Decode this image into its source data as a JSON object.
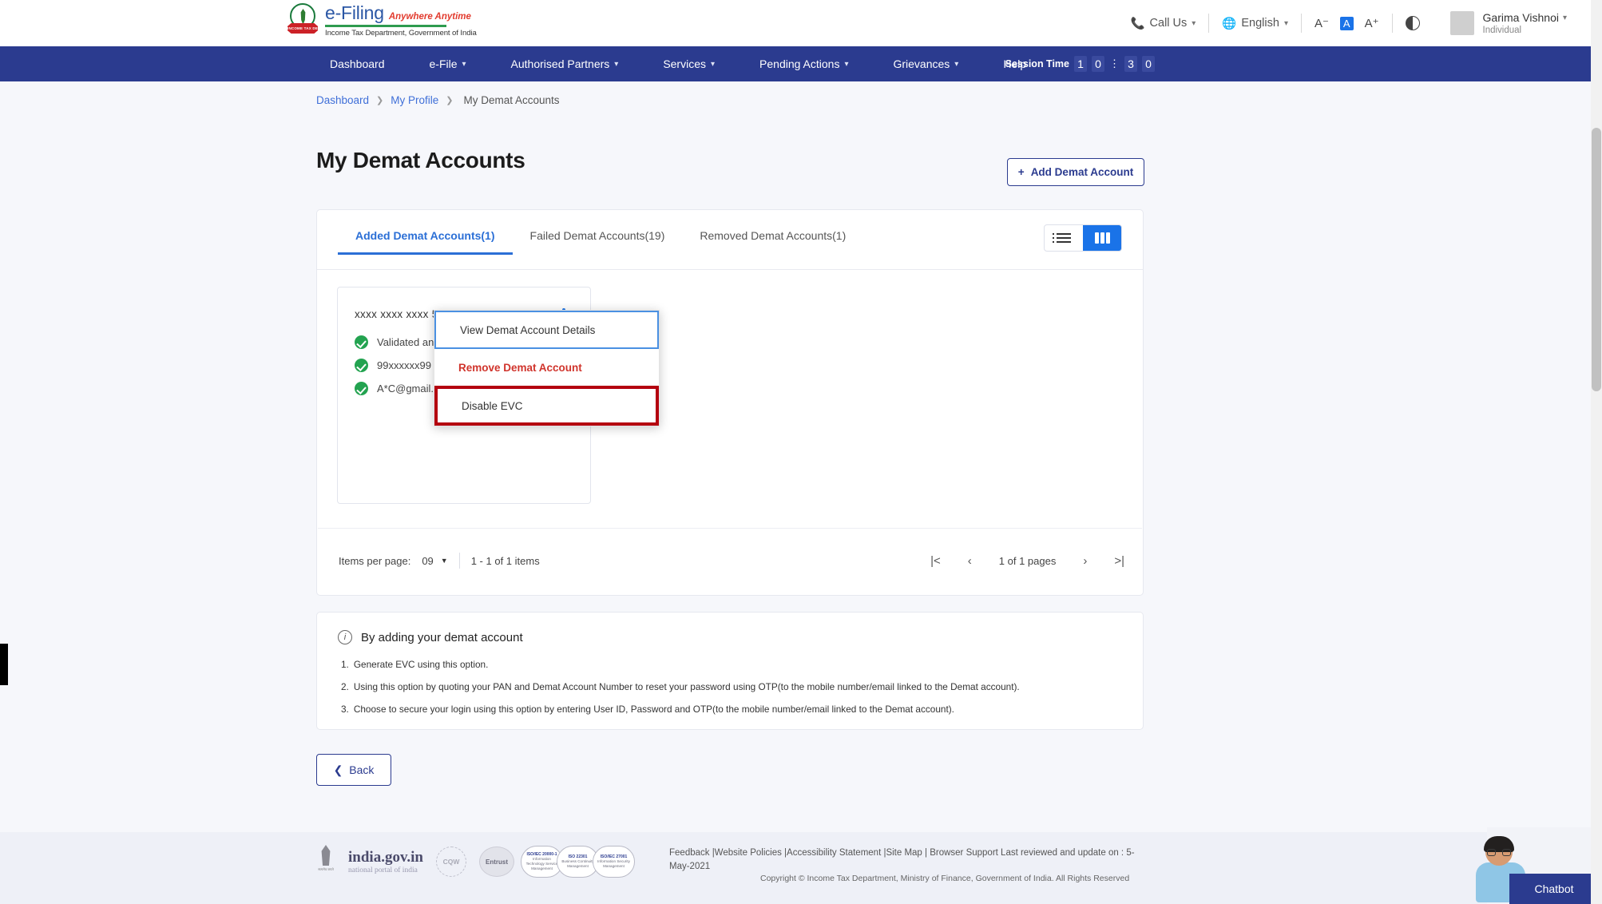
{
  "header": {
    "logo": {
      "brand": "e-Filing",
      "tagline": "Anywhere Anytime",
      "department": "Income Tax Department, Government of India",
      "emblem_text": "INCOME TAX DEPARTMENT"
    },
    "call_us": "Call Us",
    "language": "English",
    "font_decrease": "A⁻",
    "font_normal": "A",
    "font_increase": "A⁺",
    "user": {
      "name": "Garima Vishnoi",
      "role": "Individual"
    }
  },
  "nav": {
    "items": [
      {
        "label": "Dashboard",
        "has_caret": false
      },
      {
        "label": "e-File",
        "has_caret": true
      },
      {
        "label": "Authorised Partners",
        "has_caret": true
      },
      {
        "label": "Services",
        "has_caret": true
      },
      {
        "label": "Pending Actions",
        "has_caret": true
      },
      {
        "label": "Grievances",
        "has_caret": true
      },
      {
        "label": "Help",
        "has_caret": false
      }
    ],
    "session_label": "Session Time",
    "session_digits": [
      "1",
      "0",
      "3",
      "0"
    ],
    "session_time": "10:30"
  },
  "breadcrumb": {
    "items": [
      "Dashboard",
      "My Profile"
    ],
    "current": "My Demat Accounts"
  },
  "page_title": "My Demat Accounts",
  "add_button": "Add Demat Account",
  "tabs": [
    {
      "label": "Added Demat Accounts(1)",
      "active": true
    },
    {
      "label": "Failed Demat Accounts(19)",
      "active": false
    },
    {
      "label": "Removed Demat Accounts(1)",
      "active": false
    }
  ],
  "view_toggle": {
    "list": "list-view",
    "grid": "grid-view",
    "active": "grid"
  },
  "demat_card": {
    "account_number": "xxxx xxxx xxxx 5678",
    "rows": [
      "Validated and EVC Enabled",
      "99xxxxxx99",
      "A*C@gmail.com"
    ]
  },
  "menu": {
    "items": [
      {
        "label": "View Demat Account Details",
        "style": "focused"
      },
      {
        "label": "Remove Demat Account",
        "style": "danger"
      },
      {
        "label": "Disable EVC",
        "style": "highlight"
      }
    ]
  },
  "pagination": {
    "items_per_page_label": "Items per page:",
    "items_per_page_value": "09",
    "range_text": "1 - 1 of 1 items",
    "page_text": "1 of 1 pages",
    "first": "|<",
    "prev": "‹",
    "next": "›",
    "last": ">|"
  },
  "info": {
    "heading": "By adding your demat account",
    "items": [
      {
        "n": "1.",
        "text": "Generate EVC using this option."
      },
      {
        "n": "2.",
        "text": "Using this option by quoting your PAN and Demat Account Number to reset your password using OTP(to the mobile number/email linked to the Demat account)."
      },
      {
        "n": "3.",
        "text": "Choose to secure your login using this option by entering User ID, Password and OTP(to the mobile number/email linked to the Demat account)."
      }
    ]
  },
  "back_button": "Back",
  "footer": {
    "india_gov_title": "india.gov.in",
    "india_gov_sub": "national portal of india",
    "emblem_caption": "सत्यमेव जयते",
    "seal_cqw": "CQW",
    "seal_entrust": "Entrust",
    "iso_badges": [
      {
        "heading": "ISO/IEC 20000-1",
        "text": "Information Technology Service Management"
      },
      {
        "heading": "ISO 22301",
        "text": "Business Continuity Management"
      },
      {
        "heading": "ISO/IEC 27001",
        "text": "Information Security Management"
      }
    ],
    "links_text": "Feedback |Website Policies |Accessibility Statement |Site Map | Browser Support  Last reviewed and update on : 5-May-2021",
    "copyright": "Copyright © Income Tax Department, Ministry of Finance, Government of India. All Rights Reserved"
  },
  "chatbot": {
    "label": "Chatbot"
  },
  "colors": {
    "nav_blue": "#2b3b8f",
    "accent_blue": "#1a73e8",
    "link_blue": "#3f6fd8",
    "danger_red": "#d0342c",
    "highlight_red": "#b4000f",
    "success_green": "#23a350"
  }
}
